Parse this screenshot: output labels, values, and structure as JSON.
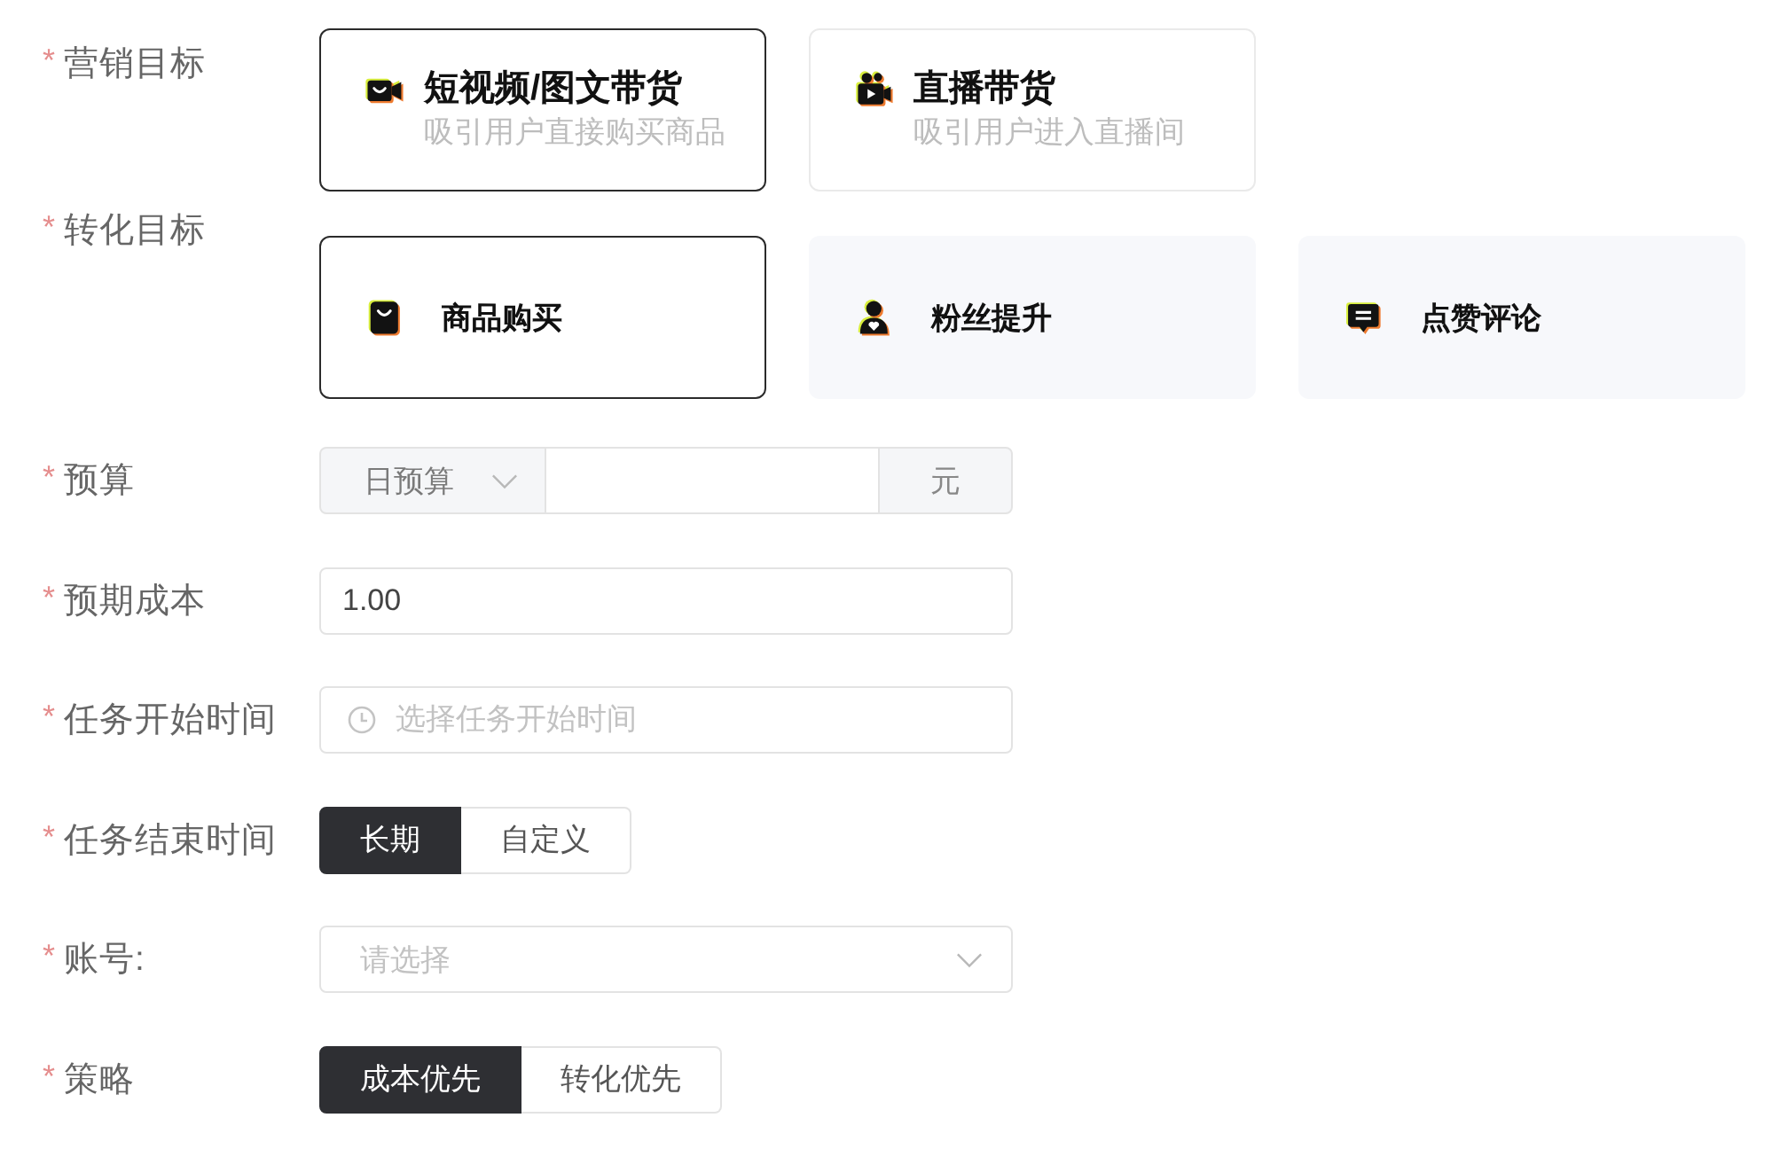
{
  "form": {
    "fields": [
      {
        "kind": "goal-cards",
        "required_mark": "*",
        "label": "营销目标",
        "options": [
          {
            "title": "短视频/图文带货",
            "subtitle": "吸引用户直接购买商品",
            "selected": true
          },
          {
            "title": "直播带货",
            "subtitle": "吸引用户进入直播间",
            "selected": false
          }
        ]
      },
      {
        "kind": "target-cards",
        "required_mark": "*",
        "label": "转化目标",
        "options": [
          {
            "title": "商品购买",
            "selected": true
          },
          {
            "title": "粉丝提升",
            "selected": false
          },
          {
            "title": "点赞评论",
            "selected": false
          }
        ]
      },
      {
        "kind": "budget",
        "required_mark": "*",
        "label": "预算",
        "period": "日预算",
        "unit": "元"
      },
      {
        "kind": "input",
        "required_mark": "*",
        "label": "预期成本",
        "value": "1.00"
      },
      {
        "kind": "time",
        "required_mark": "*",
        "label": "任务开始时间",
        "placeholder": "选择任务开始时间"
      },
      {
        "kind": "segmented",
        "required_mark": "*",
        "label": "任务结束时间",
        "options": [
          {
            "label": "长期",
            "selected": true
          },
          {
            "label": "自定义",
            "selected": false
          }
        ]
      },
      {
        "kind": "select",
        "required_mark": "*",
        "label": "账号:",
        "placeholder": "请选择"
      },
      {
        "kind": "segmented",
        "required_mark": "*",
        "label": "策略",
        "options": [
          {
            "label": "成本优先",
            "selected": true
          },
          {
            "label": "转化优先",
            "selected": false
          }
        ]
      }
    ]
  }
}
